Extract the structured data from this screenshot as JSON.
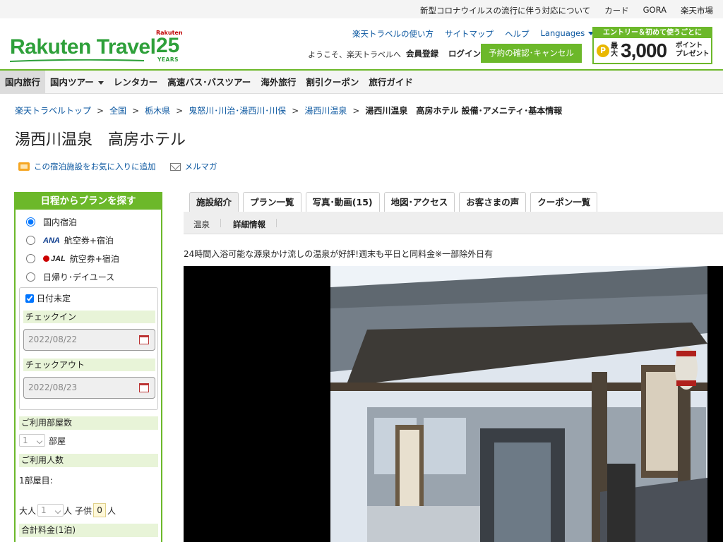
{
  "utility_links": [
    "新型コロナウイルスの流行に伴う対応について",
    "カード",
    "GORA",
    "楽天市場"
  ],
  "header": {
    "logo": "Rakuten Travel",
    "anniv_brand": "Rakuten",
    "anniv_num": "25",
    "anniv_years": "YEARS",
    "links": {
      "howto": "楽天トラベルの使い方",
      "sitemap": "サイトマップ",
      "help": "ヘルプ",
      "languages": "Languages"
    },
    "welcome": "ようこそ、楽天トラベルへ",
    "register": "会員登録",
    "login": "ログイン",
    "reservation_button": "予約の確認･キャンセル",
    "promo": {
      "top": "エントリー＆初めて使うごとに",
      "coin": "P",
      "max": "最大",
      "amount": "3,000",
      "text1": "ポイント",
      "text2": "プレゼント"
    }
  },
  "nav": [
    "国内旅行",
    "国内ツアー",
    "レンタカー",
    "高速バス･バスツアー",
    "海外旅行",
    "割引クーポン",
    "旅行ガイド"
  ],
  "breadcrumb": {
    "items": [
      "楽天トラベルトップ",
      "全国",
      "栃木県",
      "鬼怒川･川治･湯西川･川俣",
      "湯西川温泉"
    ],
    "sep": ">",
    "current": "湯西川温泉　高房ホテル 設備･アメニティ･基本情報"
  },
  "page_title": "湯西川温泉　高房ホテル",
  "actions": {
    "favorite": "この宿泊施設をお気に入りに追加",
    "mailmag": "メルマガ"
  },
  "sidebar": {
    "heading": "日程からプランを探す",
    "options": {
      "domestic": "国内宿泊",
      "ana_logo": "ANA",
      "ana": "航空券+宿泊",
      "jal_logo": "JAL",
      "jal": "航空券+宿泊",
      "day": "日帰り･デイユース"
    },
    "date_undecided": "日付未定",
    "checkin_label": "チェックイン",
    "checkin_value": "2022/08/22",
    "checkout_label": "チェックアウト",
    "checkout_value": "2022/08/23",
    "rooms_label": "ご利用部屋数",
    "rooms_value": "1",
    "rooms_unit": "部屋",
    "guests_label": "ご利用人数",
    "room1": "1部屋目:",
    "adult": "大人",
    "adult_value": "1",
    "person": "人",
    "child": "子供",
    "child_value": "0",
    "total_label": "合計料金(1泊)"
  },
  "tabs": [
    "施設紹介",
    "プラン一覧",
    "写真･動画(15)",
    "地図･アクセス",
    "お客さまの声",
    "クーポン一覧"
  ],
  "subtabs": [
    "温泉",
    "詳細情報"
  ],
  "lead": "24時間入浴可能な源泉かけ流しの温泉が好評!週末も平日と同料金※一部除外日有"
}
